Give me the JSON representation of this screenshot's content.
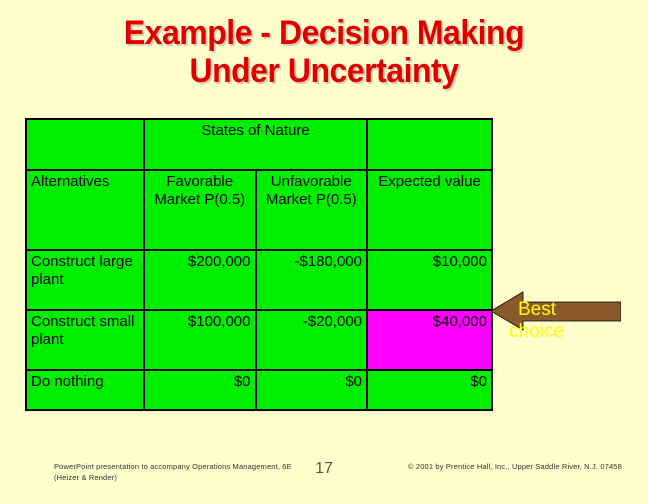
{
  "slide": {
    "title": "Example - Decision Making\nUnder Uncertainty",
    "background_color": "#FFFFCC",
    "title_color": "#E00000"
  },
  "table": {
    "cell_color": "#00EE00",
    "highlight_color": "#FF00FF",
    "border_color": "#000000",
    "group_header": "States of Nature",
    "headers": {
      "alternatives": "Alternatives",
      "favorable": "Favorable Market P(0.5)",
      "unfavorable": "Unfavorable Market P(0.5)",
      "expected": "Expected value"
    },
    "rows": [
      {
        "alternative": "Construct large plant",
        "favorable": "$200,000",
        "unfavorable": "-$180,000",
        "expected": "$10,000",
        "highlighted": false
      },
      {
        "alternative": "Construct small plant",
        "favorable": "$100,000",
        "unfavorable": "-$20,000",
        "expected": "$40,000",
        "highlighted": true
      },
      {
        "alternative": "Do nothing",
        "favorable": "$0",
        "unfavorable": "$0",
        "expected": "$0",
        "highlighted": false
      }
    ]
  },
  "callout": {
    "line1": "Best",
    "line2": "choice",
    "arrow_color": "#8B5A2B",
    "text_color": "#FFFF00",
    "direction": "left"
  },
  "footer": {
    "left": "PowerPoint presentation to accompany Operations Management, 6E (Heizer & Render)",
    "page": "17",
    "right": "© 2001 by Prentice Hall, Inc.,  Upper Saddle River, N.J. 07458"
  }
}
